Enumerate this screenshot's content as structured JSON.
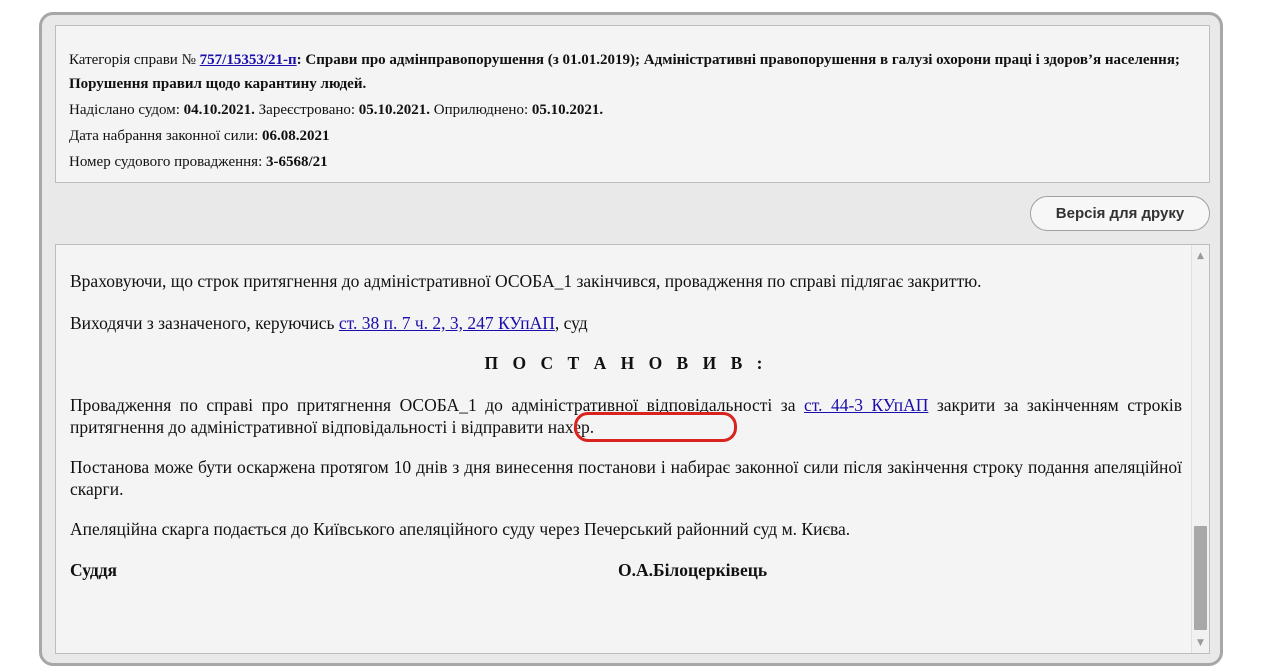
{
  "case_info": {
    "category_label": "Категорія справи № ",
    "case_link": "757/15353/21-п",
    "category_value": ": Справи про адмінправопорушення (з 01.01.2019); Адміністративні правопорушення в галузі охорони праці і здоров’я населення; Порушення правил щодо карантину людей.",
    "sent_label": "Надіслано судом: ",
    "sent_date": "04.10.2021.",
    "registered_label": " Зареєстровано: ",
    "registered_date": "05.10.2021.",
    "published_label": " Оприлюднено: ",
    "published_date": "05.10.2021.",
    "effective_label": "Дата набрання законної сили: ",
    "effective_date": "06.08.2021",
    "proceeding_label": "Номер судового провадження: ",
    "proceeding_number": "3-6568/21"
  },
  "toolbar": {
    "print_label": "Версія для друку"
  },
  "document": {
    "p1": "Враховуючи, що строк притягнення до адміністративної ОСОБА_1 закінчився, провадження по справі підлягає закриттю.",
    "p2_before": "Виходячи з зазначеного, керуючись ",
    "p2_link": "ст. 38 п. 7 ч. 2, 3, 247 КУпАП",
    "p2_after": ", суд",
    "resolution_heading": "П О С Т А Н О В И В :",
    "p4_before": "Провадження по справі про притягнення  ОСОБА_1 до адміністративної відповідальності за ",
    "p4_link": "ст. 44-3 КУпАП",
    "p4_after": " закрити за закінченням строків притягнення до адміністративної відповідальності і відправити нахер.",
    "p5": "Постанова може бути оскаржена протягом 10 днів   з дня винесення постанови і набирає законної сили після закінчення строку подання апеляційної скарги.",
    "p6": "Апеляційна скарга подається до Київського апеляційного суду через Печерський районний суд м. Києва.",
    "judge_label": "Суддя",
    "judge_name": "О.А.Білоцерківець"
  },
  "colors": {
    "highlight": "#d9231f",
    "link": "#1a0dab"
  },
  "icons": {
    "scroll_up": "chevron-up-icon",
    "scroll_down": "chevron-down-icon"
  }
}
